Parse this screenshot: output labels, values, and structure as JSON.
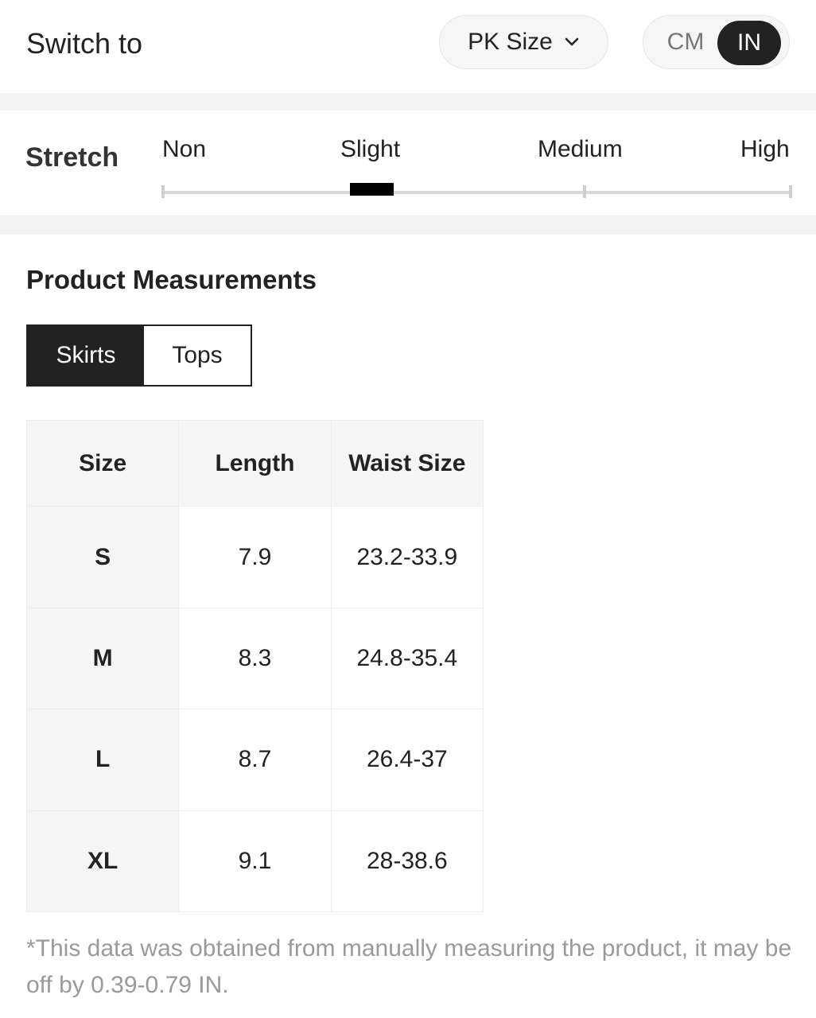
{
  "header": {
    "switch_label": "Switch to",
    "size_system": "PK Size",
    "units": {
      "cm": "CM",
      "in": "IN",
      "selected": "IN"
    }
  },
  "stretch": {
    "title": "Stretch",
    "levels": [
      "Non",
      "Slight",
      "Medium",
      "High"
    ],
    "selected": "Slight"
  },
  "measurements": {
    "title": "Product Measurements",
    "tabs": [
      {
        "label": "Skirts",
        "active": true
      },
      {
        "label": "Tops",
        "active": false
      }
    ],
    "columns": [
      "Size",
      "Length",
      "Waist Size"
    ],
    "rows": [
      [
        "S",
        "7.9",
        "23.2-33.9"
      ],
      [
        "M",
        "8.3",
        "24.8-35.4"
      ],
      [
        "L",
        "8.7",
        "26.4-37"
      ],
      [
        "XL",
        "9.1",
        "28-38.6"
      ]
    ],
    "note": "*This data was obtained from manually measuring the product, it may be off by 0.39-0.79 IN."
  },
  "icons": {
    "dropdown": "chevron-down-icon"
  },
  "colors": {
    "active": "#222222",
    "muted": "#9a9a9a",
    "panel": "#f5f5f5"
  }
}
